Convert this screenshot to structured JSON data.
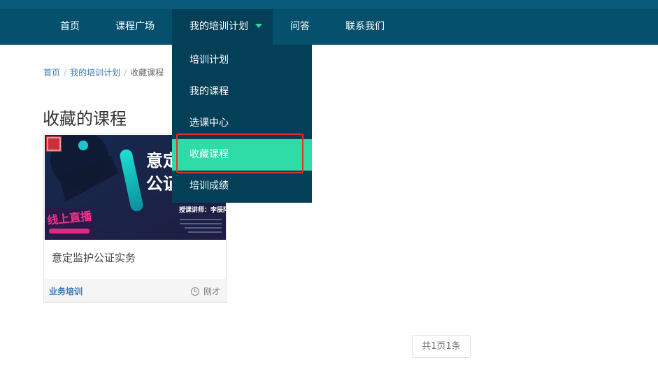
{
  "nav": {
    "items": [
      {
        "label": "首页"
      },
      {
        "label": "课程广场"
      },
      {
        "label": "我的培训计划"
      },
      {
        "label": "问答"
      },
      {
        "label": "联系我们"
      }
    ]
  },
  "dropdown": {
    "items": [
      {
        "label": "培训计划"
      },
      {
        "label": "我的课程"
      },
      {
        "label": "选课中心"
      },
      {
        "label": "收藏课程"
      },
      {
        "label": "培训成绩"
      }
    ]
  },
  "breadcrumb": {
    "home": "首页",
    "plan": "我的培训计划",
    "current": "收藏课程"
  },
  "page": {
    "title": "收藏的课程"
  },
  "course": {
    "title": "意定监护公证实务",
    "tag": "业务培训",
    "time": "刚才",
    "thumb": {
      "heading": "意定监护公证",
      "lecturer": "授课讲师：李辰阳",
      "live": "线上直播"
    }
  },
  "pagination": {
    "summary": "共1页1条"
  },
  "colors": {
    "navbar": "#04506d",
    "active": "#033f57",
    "accent": "#2fdca8",
    "highlight": "#e4322a",
    "link": "#3a78b5"
  }
}
